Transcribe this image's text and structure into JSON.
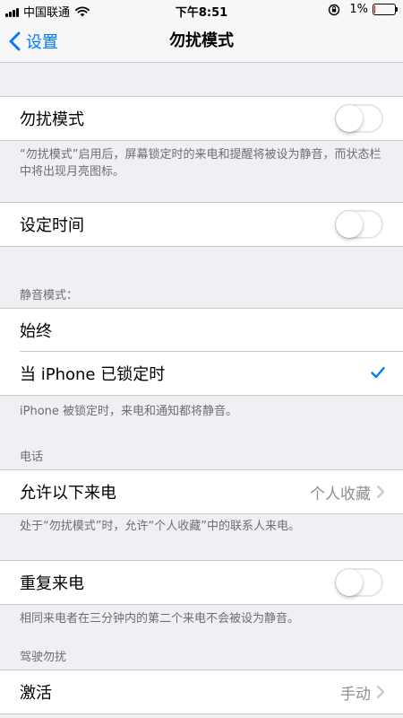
{
  "status_bar": {
    "carrier": "中国联通",
    "time": "下午8:51",
    "battery_percent": "1%",
    "battery_level": 0.01
  },
  "nav": {
    "back_label": "设置",
    "title": "勿扰模式"
  },
  "dnd": {
    "label": "勿扰模式",
    "enabled": false,
    "footer": "“勿扰模式”启用后，屏幕锁定时的来电和提醒将被设为静音，而状态栏中将出现月亮图标。"
  },
  "scheduled": {
    "label": "设定时间",
    "enabled": false
  },
  "silence": {
    "header": "静音模式：",
    "options": [
      {
        "label": "始终",
        "selected": false
      },
      {
        "label": "当 iPhone 已锁定时",
        "selected": true
      }
    ],
    "footer": "iPhone 被锁定时，来电和通知都将静音。"
  },
  "phone": {
    "header": "电话",
    "allow_calls_label": "允许以下来电",
    "allow_calls_value": "个人收藏",
    "allow_footer": "处于“勿扰模式”时，允许“个人收藏”中的联系人来电。",
    "repeated_label": "重复来电",
    "repeated_enabled": false,
    "repeated_footer": "相同来电者在三分钟内的第二个来电不会被设为静音。"
  },
  "driving": {
    "header": "驾驶勿扰",
    "activate_label": "激活",
    "activate_value": "手动"
  },
  "colors": {
    "accent": "#007aff",
    "background": "#efeff4",
    "secondary_text": "#8e8e93"
  }
}
